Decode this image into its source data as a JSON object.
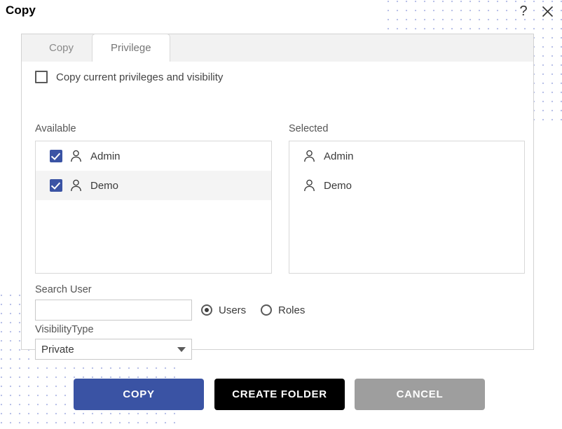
{
  "header": {
    "title": "Copy",
    "help_icon": "question-mark-icon",
    "close_icon": "close-x-icon"
  },
  "tabs": [
    {
      "label": "Copy",
      "active": false
    },
    {
      "label": "Privilege",
      "active": true
    }
  ],
  "form": {
    "copy_privileges_label": "Copy current privileges and visibility",
    "copy_privileges_checked": false,
    "available_label": "Available",
    "selected_label": "Selected",
    "available_items": [
      {
        "label": "Admin",
        "checked": true,
        "highlighted": false
      },
      {
        "label": "Demo",
        "checked": true,
        "highlighted": true
      }
    ],
    "selected_items": [
      {
        "label": "Admin"
      },
      {
        "label": "Demo"
      }
    ],
    "search_label": "Search User",
    "search_value": "",
    "search_placeholder": "",
    "radio_users_label": "Users",
    "radio_roles_label": "Roles",
    "radio_selected": "Users",
    "visibility_label": "VisibilityType",
    "visibility_value": "Private"
  },
  "footer": {
    "copy_label": "COPY",
    "create_folder_label": "CREATE FOLDER",
    "cancel_label": "CANCEL"
  },
  "colors": {
    "accent_blue": "#3a53a4",
    "black_button": "#000000",
    "gray_button": "#9e9e9e",
    "dot_pattern": "#b9c1e8",
    "panel_border": "#d2d2d2",
    "tabstrip_bg": "#f2f2f2"
  }
}
